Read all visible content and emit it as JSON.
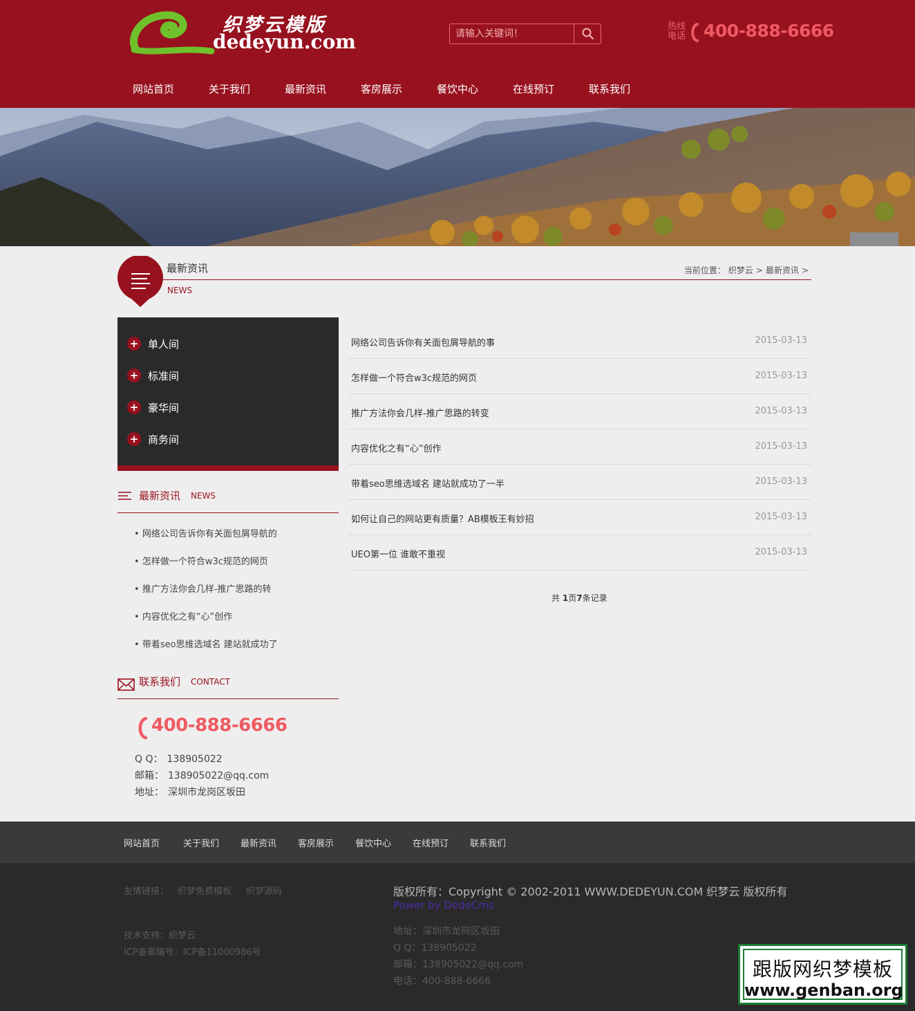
{
  "header": {
    "logo_cn": "织梦云模版",
    "logo_en": "dedeyun.com",
    "search_placeholder": "请输入关键词！",
    "hotline_label": "热线电话",
    "hotline_number": "400-888-6666",
    "nav": [
      "网站首页",
      "关于我们",
      "最新资讯",
      "客房展示",
      "餐饮中心",
      "在线预订",
      "联系我们"
    ]
  },
  "title": {
    "cn": "最新资讯",
    "en": "NEWS",
    "breadcrumb": [
      "当前位置：",
      "织梦云",
      ">",
      "最新资讯",
      ">"
    ]
  },
  "categories": [
    "单人间",
    "标准间",
    "豪华间",
    "商务间"
  ],
  "side_news": {
    "title": "最新资讯",
    "en": "NEWS",
    "items": [
      "网络公司告诉你有关面包屑导航的",
      "怎样做一个符合w3c规范的网页",
      "推广方法你会几样-推广思路的转",
      "内容优化之有“心”创作",
      "带着seo思维选域名 建站就成功了"
    ]
  },
  "contact": {
    "title": "联系我们",
    "en": "CONTACT",
    "phone": "400-888-6666",
    "qq_label": "Q Q：",
    "qq": "138905022",
    "email_label": "邮箱：",
    "email": "138905022@qq.com",
    "address_label": "地址：",
    "address": "深圳市龙岗区坂田"
  },
  "articles": [
    {
      "title": "网络公司告诉你有关面包屑导航的事",
      "date": "2015-03-13"
    },
    {
      "title": "怎样做一个符合w3c规范的网页",
      "date": "2015-03-13"
    },
    {
      "title": "推广方法你会几样-推广思路的转变",
      "date": "2015-03-13"
    },
    {
      "title": "内容优化之有“心”创作",
      "date": "2015-03-13"
    },
    {
      "title": "带着seo思维选域名 建站就成功了一半",
      "date": "2015-03-13"
    },
    {
      "title": "如何让自己的网站更有质量？AB模板王有妙招",
      "date": "2015-03-13"
    },
    {
      "title": "UEO第一位 谁敢不重视",
      "date": "2015-03-13"
    }
  ],
  "pagination": {
    "prefix": "共 ",
    "pages": "1",
    "mid": "页",
    "records": "7",
    "suffix": "条记录"
  },
  "footer_nav": [
    "网站首页",
    "关于我们",
    "最新资讯",
    "客房展示",
    "餐饮中心",
    "在线预订",
    "联系我们"
  ],
  "footer": {
    "links_label": "友情链接：",
    "links": [
      "织梦免费模板",
      "织梦源码"
    ],
    "support": "技术支持：织梦云",
    "icp": "ICP备案编号：ICP备11000986号",
    "copyright": "版权所有：Copyright © 2002-2011 WWW.DEDEYUN.COM 织梦云 版权所有",
    "power": "Power by DedeCms",
    "address": "地址：深圳市龙岗区坂田",
    "qq": "Q Q：138905022",
    "email": "邮箱：138905022@qq.com",
    "phone": "电话：400-888-6666"
  },
  "watermark": {
    "cn": "跟版网织梦模板",
    "url": "www.genban.org"
  },
  "colors": {
    "brand": "#98111e",
    "accent": "#f05a64",
    "dark": "#2a2a2a"
  }
}
